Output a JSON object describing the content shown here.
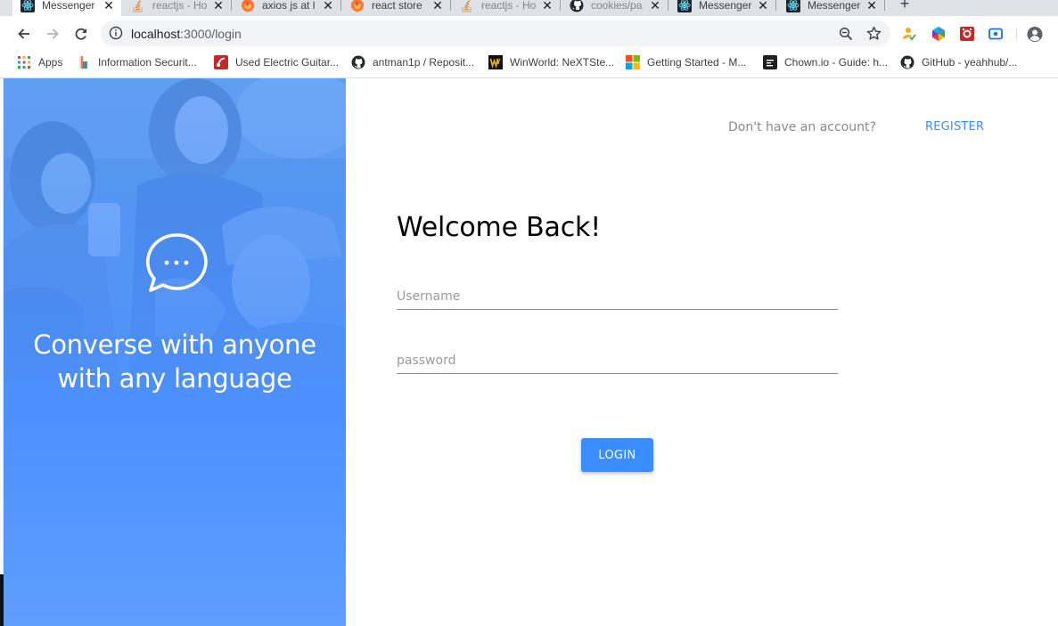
{
  "browser": {
    "tabs": [
      {
        "title": "Messenger",
        "favicon": "react-icon",
        "active": true
      },
      {
        "title": "reactjs - Ho",
        "favicon": "stackoverflow-icon",
        "active": false
      },
      {
        "title": "axios js at l",
        "favicon": "firefox-icon",
        "active": false
      },
      {
        "title": "react store",
        "favicon": "firefox-icon",
        "active": false
      },
      {
        "title": "reactjs - Ho",
        "favicon": "stackoverflow-icon",
        "active": false
      },
      {
        "title": "cookies/pa",
        "favicon": "github-icon",
        "active": false
      },
      {
        "title": "Messenger",
        "favicon": "react-icon",
        "active": false
      },
      {
        "title": "Messenger",
        "favicon": "react-icon",
        "active": false
      }
    ],
    "address": {
      "host": "localhost",
      "path": ":3000/login"
    },
    "bookmarks": [
      {
        "label": "Apps",
        "icon": "apps-grid-icon"
      },
      {
        "label": "Information Securit...",
        "icon": "bookmark-favicon"
      },
      {
        "label": "Used Electric Guitar...",
        "icon": "bookmark-favicon"
      },
      {
        "label": "antman1p / Reposit...",
        "icon": "github-icon"
      },
      {
        "label": "WinWorld: NeXTSte...",
        "icon": "bookmark-favicon"
      },
      {
        "label": "Getting Started - M...",
        "icon": "microsoft-icon"
      },
      {
        "label": "Chown.io - Guide: h...",
        "icon": "bookmark-favicon"
      },
      {
        "label": "GitHub - yeahhub/...",
        "icon": "github-icon"
      }
    ]
  },
  "hero": {
    "tagline_line1": "Converse with anyone",
    "tagline_line2": "with any language",
    "icon": "chat-bubble-icon"
  },
  "auth": {
    "prompt": "Don't have an account?",
    "register_label": "REGISTER",
    "heading": "Welcome Back!",
    "username": {
      "placeholder": "Username",
      "value": ""
    },
    "password": {
      "placeholder": "password",
      "value": ""
    },
    "login_label": "LOGIN"
  },
  "colors": {
    "accent": "#3a8dff",
    "hero_top": "#6c9ff0",
    "hero_bottom": "#5d9dff"
  }
}
